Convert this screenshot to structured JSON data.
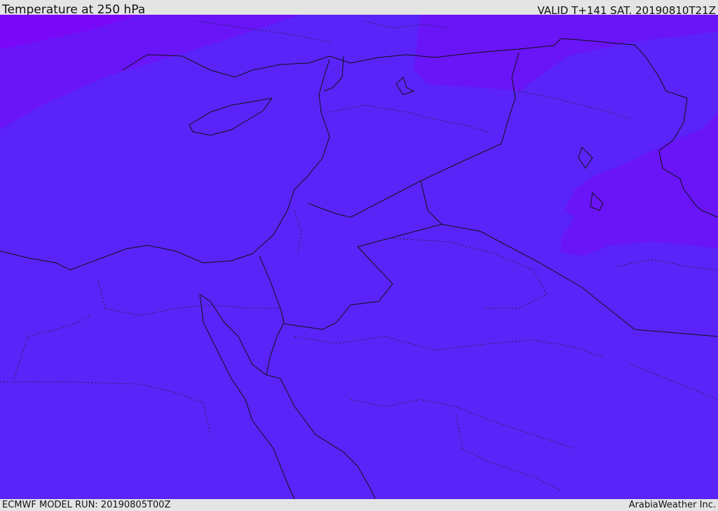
{
  "header": {
    "title": "Temperature at 250 hPa",
    "valid": "VALID T+141 SAT. 20190810T21Z"
  },
  "footer": {
    "model_run": "ECMWF MODEL RUN: 20190805T00Z",
    "credit": "ArabiaWeather Inc."
  },
  "map": {
    "field": "temperature",
    "level": "250 hPa",
    "colors": {
      "background_fill": "#5a24f8",
      "warm_band": "#6618f8",
      "warmest_band": "#7a08f8",
      "border_line": "#111111",
      "country_line": "#222244"
    }
  }
}
